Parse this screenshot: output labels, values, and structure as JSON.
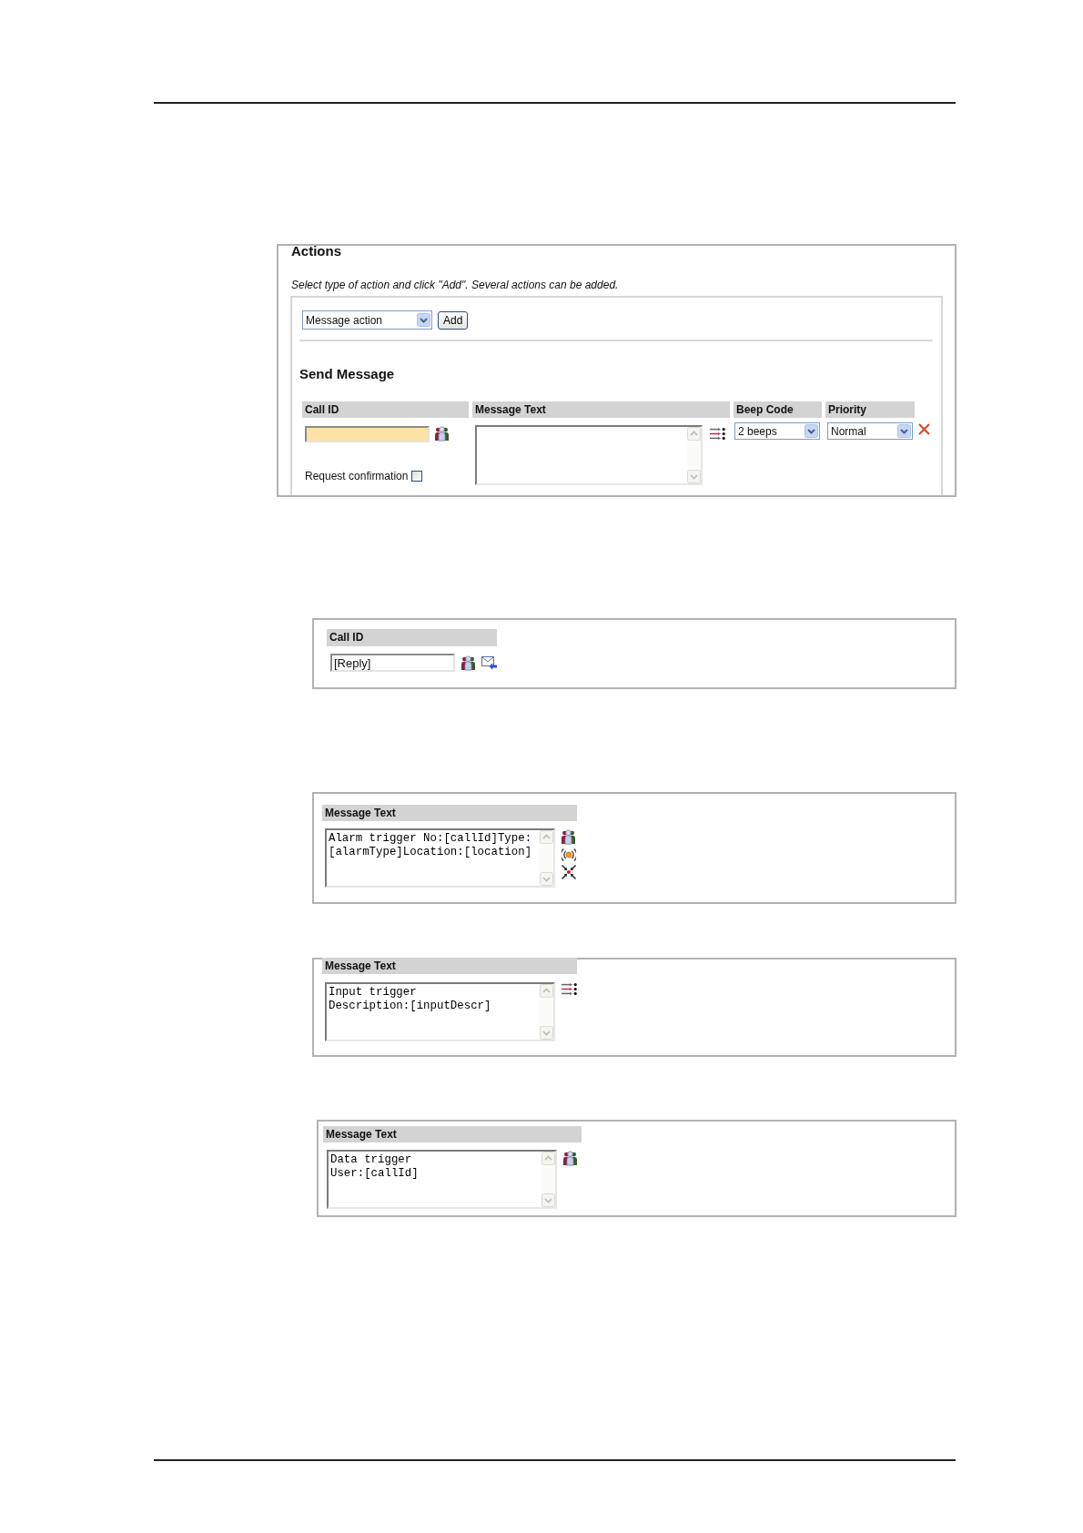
{
  "actions_panel": {
    "title": "Actions",
    "instruction": "Select type of action and click \"Add\". Several actions can be added.",
    "action_type": "Message action",
    "add_button": "Add",
    "section_title": "Send Message",
    "columns": [
      "Call ID",
      "Message Text",
      "Beep Code",
      "Priority"
    ],
    "call_id": {
      "highlighted": true,
      "tools": [
        {
          "kind": "users"
        }
      ]
    },
    "request_confirmation": {
      "label": "Request confirmation",
      "checked": false
    },
    "message_text": {
      "tools": [
        {
          "kind": "list"
        }
      ]
    },
    "beep_code": "2 beeps",
    "priority": "Normal"
  },
  "call_id_panel": {
    "column": "Call ID",
    "value": "[Reply]",
    "tools": [
      {
        "kind": "users"
      },
      {
        "kind": "envelope"
      }
    ]
  },
  "message_panels": [
    {
      "column": "Message Text",
      "lines": [
        "Alarm trigger No:[callId]Type:",
        "[alarmType]Location:[location]"
      ],
      "tools": [
        {
          "kind": "users"
        },
        {
          "kind": "broadcast"
        },
        {
          "kind": "converge"
        }
      ]
    },
    {
      "column": "Message Text",
      "lines": [
        "Input trigger",
        "Description:[inputDescr]"
      ],
      "tools": [
        {
          "kind": "list"
        }
      ]
    },
    {
      "column": "Message Text",
      "lines": [
        "Data trigger",
        "User:[callId]"
      ],
      "tools": [
        {
          "kind": "users"
        }
      ]
    }
  ]
}
